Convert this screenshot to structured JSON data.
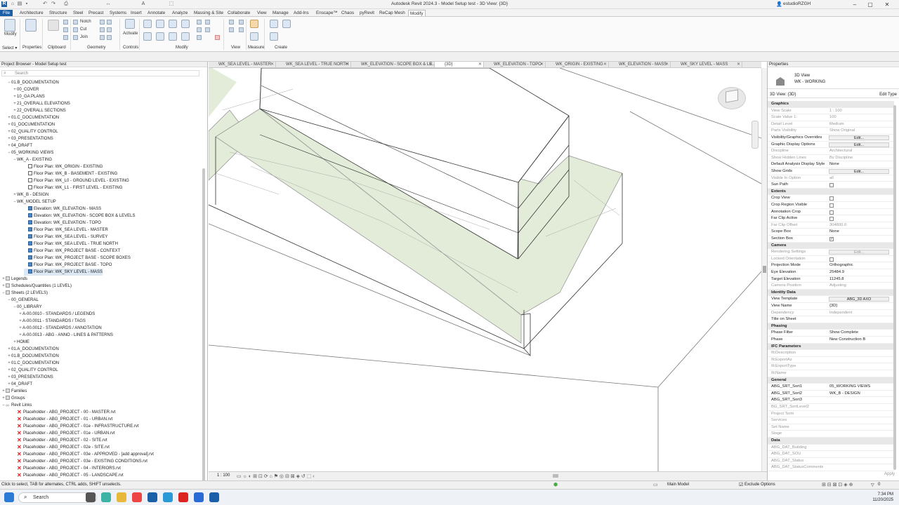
{
  "window": {
    "title": "Autodesk Revit 2024.3 - Model Setup test - 3D View: {3D}",
    "user": "estudioRZGH"
  },
  "menu": {
    "tabs": [
      "File",
      "Architecture",
      "Structure",
      "Steel",
      "Precast",
      "Systems",
      "Insert",
      "Annotate",
      "Analyze",
      "Massing & Site",
      "Collaborate",
      "View",
      "Manage",
      "Add-Ins",
      "Enscape™",
      "Chaos",
      "pyRevit",
      "ReCap Mesh",
      "Modify"
    ],
    "active": "Modify"
  },
  "ribbon": {
    "modify_label": "Modify",
    "notch": "Notch",
    "cut": "Cut",
    "join": "Join",
    "activate": "Activate",
    "groups": {
      "select": "Select ▾",
      "properties": "Properties",
      "clipboard": "Clipboard",
      "geometry": "Geometry",
      "controls": "Controls",
      "modify": "Modify",
      "view": "View",
      "measure": "Measure",
      "create": "Create"
    }
  },
  "project_browser": {
    "title": "Project Browser - Model Setup test",
    "search_placeholder": "Search",
    "items": [
      {
        "exp": "−",
        "icon": "none",
        "label": "01.B_DOCUMENTATION"
      },
      {
        "exp": "+",
        "icon": "none",
        "label": "00_COVER"
      },
      {
        "exp": "+",
        "icon": "none",
        "label": "10_GA PLANS"
      },
      {
        "exp": "+",
        "icon": "none",
        "label": "21_OVERALL ELEVATIONS"
      },
      {
        "exp": "+",
        "icon": "none",
        "label": "22_OVERALL SECTIONS"
      },
      {
        "exp": "+",
        "icon": "none",
        "label": "01.C_DOCUMENTATION"
      },
      {
        "exp": "+",
        "icon": "none",
        "label": "01_DOCUMENTATION"
      },
      {
        "exp": "+",
        "icon": "none",
        "label": "02_QUALITY CONTROL"
      },
      {
        "exp": "+",
        "icon": "none",
        "label": "03_PRESENTATIONS"
      },
      {
        "exp": "+",
        "icon": "none",
        "label": "04_DRAFT"
      },
      {
        "exp": "−",
        "icon": "none",
        "label": "05_WORKING VIEWS"
      },
      {
        "exp": "−",
        "icon": "none",
        "label": "WK_A - EXISTING"
      },
      {
        "exp": "",
        "icon": "fp",
        "label": "Floor Plan: WK_ORIGIN - EXISTING"
      },
      {
        "exp": "",
        "icon": "fp",
        "label": "Floor Plan: WK_B - BASEMENT - EXISTING"
      },
      {
        "exp": "",
        "icon": "fp",
        "label": "Floor Plan: WK_L0 - GROUND LEVEL - EXISTING"
      },
      {
        "exp": "",
        "icon": "fp",
        "label": "Floor Plan: WK_L1 - FIRST LEVEL - EXISTING"
      },
      {
        "exp": "+",
        "icon": "none",
        "label": "WK_B - DESIGN"
      },
      {
        "exp": "−",
        "icon": "none",
        "label": "WK_MODEL SETUP"
      },
      {
        "exp": "",
        "icon": "el",
        "label": "Elevation: WK_ELEVATION - MASS"
      },
      {
        "exp": "",
        "icon": "el",
        "label": "Elevation: WK_ELEVATION - SCOPE BOX & LEVELS"
      },
      {
        "exp": "",
        "icon": "el",
        "label": "Elevation: WK_ELEVATION - TOPO"
      },
      {
        "exp": "",
        "icon": "el",
        "label": "Floor Plan: WK_SEA LEVEL - MASTER"
      },
      {
        "exp": "",
        "icon": "el",
        "label": "Floor Plan: WK_SEA LEVEL - SURVEY"
      },
      {
        "exp": "",
        "icon": "el",
        "label": "Floor Plan: WK_SEA LEVEL - TRUE NORTH"
      },
      {
        "exp": "",
        "icon": "el",
        "label": "Floor Plan: WK_PROJECT BASE - CONTEXT"
      },
      {
        "exp": "",
        "icon": "el",
        "label": "Floor Plan: WK_PROJECT BASE - SCOPE BOXES"
      },
      {
        "exp": "",
        "icon": "el",
        "label": "Floor Plan: WK_PROJECT BASE - TOPO"
      },
      {
        "exp": "",
        "icon": "el",
        "label": "Floor Plan: WK_SKY LEVEL - MASS"
      },
      {
        "exp": "+",
        "icon": "fold",
        "label": "Legends"
      },
      {
        "exp": "+",
        "icon": "fold",
        "label": "Schedules/Quantities (1 LEVEL)"
      },
      {
        "exp": "−",
        "icon": "fold",
        "label": "Sheets (2 LEVELS)"
      },
      {
        "exp": "−",
        "icon": "none",
        "label": "00_GENERAL"
      },
      {
        "exp": "−",
        "icon": "none",
        "label": "00_LIBRARY"
      },
      {
        "exp": "+",
        "icon": "none",
        "label": "A-00.0010 - STANDARDS / LEGENDS"
      },
      {
        "exp": "+",
        "icon": "none",
        "label": "A-00.0011 - STANDARDS / TAGS"
      },
      {
        "exp": "+",
        "icon": "none",
        "label": "A-00.0012 - STANDARDS / ANNOTATION"
      },
      {
        "exp": "+",
        "icon": "none",
        "label": "A-00.0013 - ABG - ANNO - LINES & PATTERNS"
      },
      {
        "exp": "+",
        "icon": "none",
        "label": "HOME"
      },
      {
        "exp": "+",
        "icon": "none",
        "label": "01.A_DOCUMENTATION"
      },
      {
        "exp": "+",
        "icon": "none",
        "label": "01.B_DOCUMENTATION"
      },
      {
        "exp": "+",
        "icon": "none",
        "label": "01.C_DOCUMENTATION"
      },
      {
        "exp": "+",
        "icon": "none",
        "label": "02_QUALITY CONTROL"
      },
      {
        "exp": "+",
        "icon": "none",
        "label": "03_PRESENTATIONS"
      },
      {
        "exp": "+",
        "icon": "none",
        "label": "04_DRAFT"
      },
      {
        "exp": "+",
        "icon": "fold",
        "label": "Families"
      },
      {
        "exp": "+",
        "icon": "fold",
        "label": "Groups"
      },
      {
        "exp": "−",
        "icon": "chain",
        "label": "Revit Links"
      },
      {
        "exp": "",
        "icon": "x",
        "label": "Placeholder - ABG_PROJECT - 00 - MASTER.rvt"
      },
      {
        "exp": "",
        "icon": "x",
        "label": "Placeholder - ABG_PROJECT - 01 - URBAN.rvt"
      },
      {
        "exp": "",
        "icon": "x",
        "label": "Placeholder - ABG_PROJECT - 01e - INFRASTRUCTURE.rvt"
      },
      {
        "exp": "",
        "icon": "x",
        "label": "Placeholder - ABG_PROJECT - 01e - URBAN.rvt"
      },
      {
        "exp": "",
        "icon": "x",
        "label": "Placeholder - ABG_PROJECT - 02 - SITE.rvt"
      },
      {
        "exp": "",
        "icon": "x",
        "label": "Placeholder - ABG_PROJECT - 02e - SITE.rvt"
      },
      {
        "exp": "",
        "icon": "x",
        "label": "Placeholder - ABG_PROJECT - 03e - APPROVED - [add approval].rvt"
      },
      {
        "exp": "",
        "icon": "x",
        "label": "Placeholder - ABG_PROJECT - 03e - EXISTING CONDITIONS.rvt"
      },
      {
        "exp": "",
        "icon": "x",
        "label": "Placeholder - ABG_PROJECT - 04 - INTERIORS.rvt"
      },
      {
        "exp": "",
        "icon": "x",
        "label": "Placeholder - ABG_PROJECT - 05 - LANDSCAPE.rvt"
      }
    ]
  },
  "view_tabs": [
    "WK_SEA LEVEL - MASTER",
    "WK_SEA LEVEL - TRUE NORTH",
    "WK_ELEVATION - SCOPE BOX & LE...",
    "{3D}",
    "WK_ELEVATION - TOPO",
    "WK_ORIGIN - EXISTING",
    "WK_ELEVATION - MASS",
    "WK_SKY LEVEL - MASS"
  ],
  "view_scale": "1 : 100",
  "properties": {
    "title": "Properties",
    "type_line1": "3D View",
    "type_line2": "WK - WORKING",
    "selector": "3D View: {3D}",
    "edit_type": "Edit Type",
    "rows": [
      {
        "kind": "group",
        "label": "Graphics"
      },
      {
        "kind": "row",
        "label": "View Scale",
        "value": "1 : 100",
        "dim": true
      },
      {
        "kind": "row",
        "label": "Scale Value    1:",
        "value": "100",
        "dim": true
      },
      {
        "kind": "row",
        "label": "Detail Level",
        "value": "Medium",
        "dim": true
      },
      {
        "kind": "row",
        "label": "Parts Visibility",
        "value": "Show Original",
        "dim": true
      },
      {
        "kind": "edit",
        "label": "Visibility/Graphics Overrides",
        "value": "Edit...",
        "dim": false
      },
      {
        "kind": "edit",
        "label": "Graphic Display Options",
        "value": "Edit...",
        "dim": false
      },
      {
        "kind": "row",
        "label": "Discipline",
        "value": "Architectural",
        "dim": true
      },
      {
        "kind": "row",
        "label": "Show Hidden Lines",
        "value": "By Discipline",
        "dim": true
      },
      {
        "kind": "row",
        "label": "Default Analysis Display Style",
        "value": "None",
        "dim": false
      },
      {
        "kind": "edit",
        "label": "Show Grids",
        "value": "Edit...",
        "dim": false
      },
      {
        "kind": "row",
        "label": "Visible In Option",
        "value": "all",
        "dim": true
      },
      {
        "kind": "check",
        "label": "Sun Path",
        "value": "",
        "dim": false
      },
      {
        "kind": "group",
        "label": "Extents"
      },
      {
        "kind": "check",
        "label": "Crop View",
        "value": "",
        "dim": false
      },
      {
        "kind": "check",
        "label": "Crop Region Visible",
        "value": "",
        "dim": false
      },
      {
        "kind": "check",
        "label": "Annotation Crop",
        "value": "",
        "dim": false
      },
      {
        "kind": "check",
        "label": "Far Clip Active",
        "value": "",
        "dim": false
      },
      {
        "kind": "row",
        "label": "Far Clip Offset",
        "value": "304800.0",
        "dim": true
      },
      {
        "kind": "row",
        "label": "Scope Box",
        "value": "None",
        "dim": false
      },
      {
        "kind": "check",
        "label": "Section Box",
        "value": "✓",
        "dim": false
      },
      {
        "kind": "group",
        "label": "Camera"
      },
      {
        "kind": "edit",
        "label": "Rendering Settings",
        "value": "Edit...",
        "dim": true
      },
      {
        "kind": "check",
        "label": "Locked Orientation",
        "value": "",
        "dim": true
      },
      {
        "kind": "row",
        "label": "Projection Mode",
        "value": "Orthographic",
        "dim": false
      },
      {
        "kind": "row",
        "label": "Eye Elevation",
        "value": "25484.9",
        "dim": false
      },
      {
        "kind": "row",
        "label": "Target Elevation",
        "value": "11245.8",
        "dim": false
      },
      {
        "kind": "row",
        "label": "Camera Position",
        "value": "Adjusting",
        "dim": true
      },
      {
        "kind": "group",
        "label": "Identity Data"
      },
      {
        "kind": "edit",
        "label": "View Template",
        "value": "ABG_3D AXO",
        "dim": false
      },
      {
        "kind": "row",
        "label": "View Name",
        "value": "{3D}",
        "dim": false
      },
      {
        "kind": "row",
        "label": "Dependency",
        "value": "Independent",
        "dim": true
      },
      {
        "kind": "row",
        "label": "Title on Sheet",
        "value": "",
        "dim": false
      },
      {
        "kind": "group",
        "label": "Phasing"
      },
      {
        "kind": "row",
        "label": "Phase Filter",
        "value": "Show Complete",
        "dim": false
      },
      {
        "kind": "row",
        "label": "Phase",
        "value": "New Construction B",
        "dim": false
      },
      {
        "kind": "group",
        "label": "IFC Parameters"
      },
      {
        "kind": "row",
        "label": "IfcDescription",
        "value": "",
        "dim": true
      },
      {
        "kind": "row",
        "label": "IfcExportAs",
        "value": "",
        "dim": true
      },
      {
        "kind": "row",
        "label": "IfcExportType",
        "value": "",
        "dim": true
      },
      {
        "kind": "row",
        "label": "IfcName",
        "value": "",
        "dim": true
      },
      {
        "kind": "group",
        "label": "General"
      },
      {
        "kind": "row",
        "label": "ABG_SRT_Sort1",
        "value": "05_WORKING VIEWS",
        "dim": false
      },
      {
        "kind": "row",
        "label": "ABG_SRT_Sort2",
        "value": "WK_B - DESIGN",
        "dim": false
      },
      {
        "kind": "row",
        "label": "ABG_SRT_Sort3",
        "value": "",
        "dim": false
      },
      {
        "kind": "row",
        "label": "BG_SRT_SortLevel2",
        "value": "",
        "dim": true
      },
      {
        "kind": "row",
        "label": "Project Term",
        "value": "",
        "dim": true
      },
      {
        "kind": "row",
        "label": "Services",
        "value": "",
        "dim": true
      },
      {
        "kind": "row",
        "label": "Set Name",
        "value": "",
        "dim": true
      },
      {
        "kind": "row",
        "label": "Stage",
        "value": "",
        "dim": true
      },
      {
        "kind": "group",
        "label": "Data"
      },
      {
        "kind": "row",
        "label": "ABG_DAT_Building",
        "value": "",
        "dim": true
      },
      {
        "kind": "row",
        "label": "ABG_DAT_SOU",
        "value": "",
        "dim": true
      },
      {
        "kind": "row",
        "label": "ABG_DAT_Status",
        "value": "",
        "dim": true
      },
      {
        "kind": "row",
        "label": "ABG_DAT_StatusComments",
        "value": "",
        "dim": true
      }
    ],
    "apply": "Apply"
  },
  "status": {
    "hint": "Click to select, TAB for alternates, CTRL adds, SHIFT unselects.",
    "model": "Main Model",
    "exclude": "Exclude Options",
    "selection_count": "0"
  },
  "taskbar": {
    "search": "Search",
    "time": "7:34 PM",
    "date": "11/20/2025"
  },
  "colors": {
    "file_tab": "#1b5fa8",
    "topo_fill": "#e3ecd9",
    "accent": "#4f86c6"
  }
}
